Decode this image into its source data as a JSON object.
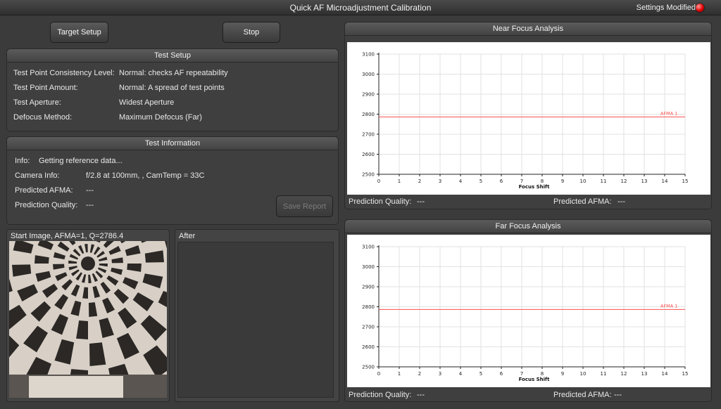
{
  "window": {
    "title": "Quick AF Microadjustment Calibration",
    "settings_modified": "Settings Modified",
    "status_color": "#e00000"
  },
  "buttons": {
    "target_setup": "Target Setup",
    "stop": "Stop",
    "save_report": "Save Report"
  },
  "test_setup": {
    "title": "Test Setup",
    "rows": [
      {
        "label": "Test Point Consistency Level:",
        "value": "Normal: checks AF repeatability"
      },
      {
        "label": "Test Point Amount:",
        "value": "Normal: A spread of test points"
      },
      {
        "label": "Test Aperture:",
        "value": "Widest Aperture"
      },
      {
        "label": "Defocus Method:",
        "value": "Maximum Defocus (Far)"
      }
    ]
  },
  "test_info": {
    "title": "Test Information",
    "info_label": "Info:",
    "info_value": "Getting reference data...",
    "rows": [
      {
        "label": "Camera Info:",
        "value": "f/2.8 at 100mm, , CamTemp = 33C"
      },
      {
        "label": "Predicted AFMA:",
        "value": "---"
      },
      {
        "label": "Prediction Quality:",
        "value": "---"
      }
    ]
  },
  "images": {
    "start_label": "Start Image, AFMA=1, Q=2786.4",
    "after_label": "After"
  },
  "near_panel": {
    "title": "Near Focus Analysis",
    "quality_label": "Prediction Quality:",
    "quality_value": "---",
    "afma_label": "Predicted AFMA:",
    "afma_value": "---"
  },
  "far_panel": {
    "title": "Far Focus Analysis",
    "quality_label": "Prediction Quality:",
    "quality_value": "---",
    "afma_label": "Predicted AFMA:",
    "afma_value": "---"
  },
  "chart_data": [
    {
      "type": "line",
      "title": "",
      "xlabel": "Focus Shift",
      "ylabel": "",
      "xlim": [
        0,
        15
      ],
      "ylim": [
        2500,
        3100
      ],
      "xticks": [
        "0",
        "1",
        "2",
        "3",
        "4",
        "5",
        "6",
        "7",
        "8",
        "9",
        "10",
        "11",
        "12",
        "13",
        "14",
        "15"
      ],
      "yticks": [
        "2500",
        "2600",
        "2700",
        "2800",
        "2900",
        "3000",
        "3100"
      ],
      "grid": true,
      "reference_lines": [
        {
          "label": "AFMA 1",
          "y": 2786.4,
          "color": "#ff4d4d"
        }
      ]
    },
    {
      "type": "line",
      "title": "",
      "xlabel": "Focus Shift",
      "ylabel": "",
      "xlim": [
        0,
        15
      ],
      "ylim": [
        2500,
        3100
      ],
      "xticks": [
        "0",
        "1",
        "2",
        "3",
        "4",
        "5",
        "6",
        "7",
        "8",
        "9",
        "10",
        "11",
        "12",
        "13",
        "14",
        "15"
      ],
      "yticks": [
        "2500",
        "2600",
        "2700",
        "2800",
        "2900",
        "3000",
        "3100"
      ],
      "grid": true,
      "reference_lines": [
        {
          "label": "AFMA 1",
          "y": 2786.4,
          "color": "#ff4d4d"
        }
      ]
    }
  ]
}
